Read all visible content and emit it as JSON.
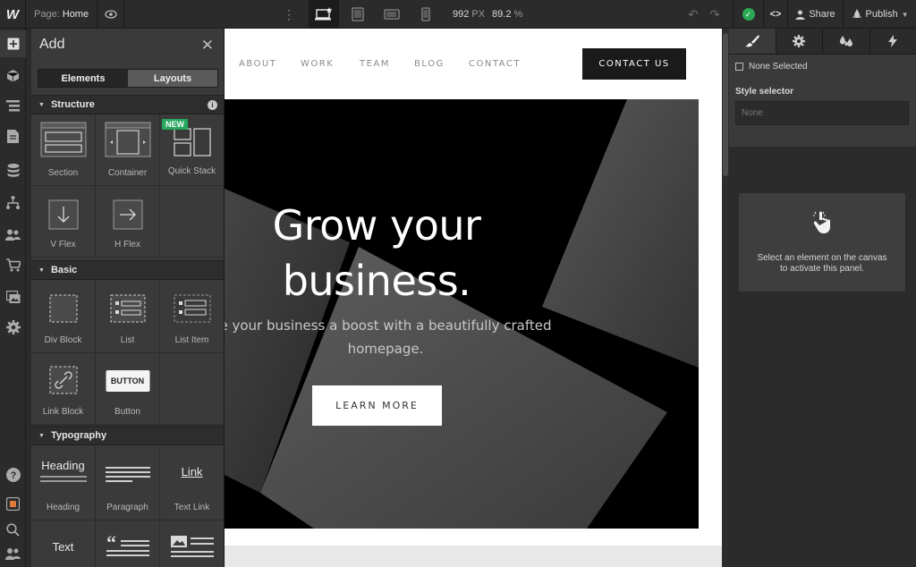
{
  "topbar": {
    "logo": "W",
    "page_label": "Page:",
    "page_value": "Home",
    "width_value": "992",
    "width_unit": "PX",
    "zoom_value": "89.2",
    "zoom_unit": "%",
    "share_label": "Share",
    "publish_label": "Publish"
  },
  "add_panel": {
    "title": "Add",
    "tabs": [
      "Elements",
      "Layouts"
    ],
    "sections": {
      "structure": "Structure",
      "basic": "Basic",
      "typography": "Typography"
    },
    "new_badge": "NEW",
    "structure_items": [
      "Section",
      "Container",
      "Quick Stack",
      "V Flex",
      "H Flex"
    ],
    "basic_items": [
      "Div Block",
      "List",
      "List Item",
      "Link Block",
      "Button"
    ],
    "button_preview": "BUTTON",
    "typography_items": [
      "Heading",
      "Paragraph",
      "Text Link",
      "Text"
    ],
    "heading_preview": "Heading",
    "link_preview": "Link"
  },
  "canvas": {
    "nav_links": [
      "ABOUT",
      "WORK",
      "TEAM",
      "BLOG",
      "CONTACT"
    ],
    "contact_button": "CONTACT US",
    "hero_title_line1": "Grow your",
    "hero_title_line2": "business.",
    "hero_sub_line1": "e your business a boost with a beautifully crafted",
    "hero_sub_line2": "homepage.",
    "learn_more": "LEARN MORE"
  },
  "right_panel": {
    "none_selected": "None Selected",
    "style_selector_label": "Style selector",
    "style_selector_placeholder": "None",
    "hint_line1": "Select an element on the canvas",
    "hint_line2": "to activate this panel."
  },
  "colors": {
    "accent_green": "#2aa954",
    "chrome_dark": "#2b2b2b",
    "panel": "#3a3a3a"
  }
}
